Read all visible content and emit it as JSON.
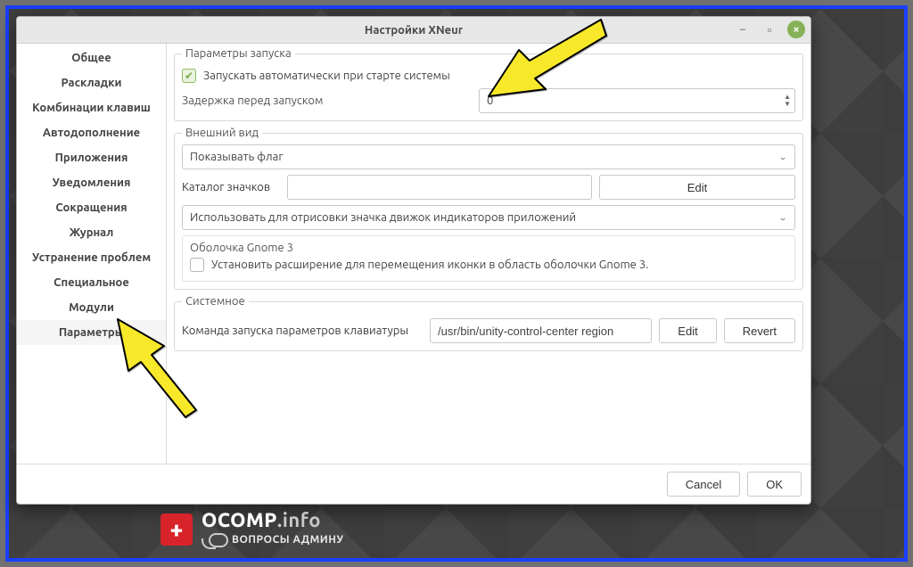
{
  "window": {
    "title": "Настройки XNeur",
    "minimize": "−",
    "maximize": "▫",
    "close": "×"
  },
  "sidebar": {
    "items": [
      "Общее",
      "Раскладки",
      "Комбинации клавиш",
      "Автодополнение",
      "Приложения",
      "Уведомления",
      "Сокращения",
      "Журнал",
      "Устранение проблем",
      "Специальное",
      "Модули",
      "Параметры"
    ],
    "active_index": 11
  },
  "startup": {
    "legend": "Параметры запуска",
    "autostart_label": "Запускать автоматически при старте системы",
    "autostart_checked": true,
    "delay_label": "Задержка перед запуском",
    "delay_value": "0"
  },
  "appearance": {
    "legend": "Внешний вид",
    "show_flag_label": "Показывать флаг",
    "icon_folder_label": "Каталог значков",
    "icon_folder_value": "",
    "edit_btn": "Edit",
    "indicator_engine_label": "Использовать для отрисовки значка движок индикаторов приложений",
    "gnome3_legend": "Оболочка Gnome 3",
    "gnome3_ext_label": "Установить расширение для перемещения иконки в область оболочки Gnome 3.",
    "gnome3_ext_checked": false
  },
  "system": {
    "legend": "Системное",
    "kb_cmd_label": "Команда запуска параметров клавиатуры",
    "kb_cmd_value": "/usr/bin/unity-control-center region",
    "edit_btn": "Edit",
    "revert_btn": "Revert"
  },
  "footer": {
    "cancel": "Cancel",
    "ok": "OK"
  },
  "logo": {
    "main": "OCOMP",
    "suffix": ".info",
    "sub": "ВОПРОСЫ АДМИНУ"
  }
}
